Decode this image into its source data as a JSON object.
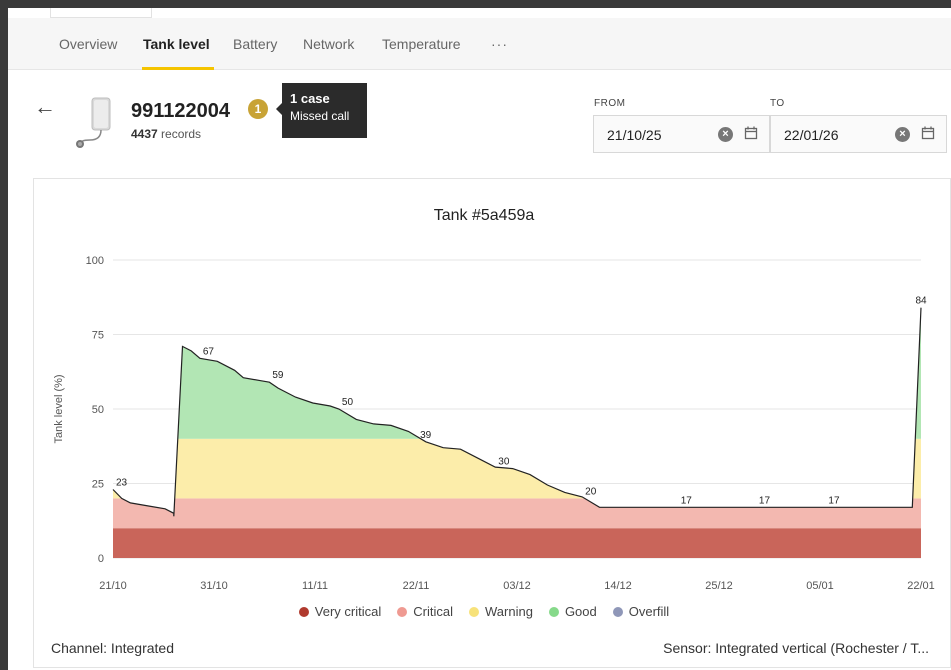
{
  "nav": {
    "tabs": [
      {
        "label": "Overview",
        "active": false
      },
      {
        "label": "Tank level",
        "active": true
      },
      {
        "label": "Battery",
        "active": false
      },
      {
        "label": "Network",
        "active": false
      },
      {
        "label": "Temperature",
        "active": false
      }
    ],
    "more_label": "···"
  },
  "device": {
    "id": "991122004",
    "records_count": "4437",
    "records_label": "records",
    "case_count": "1"
  },
  "tooltip": {
    "title": "1 case",
    "subtitle": "Missed call"
  },
  "dates": {
    "from_label": "FROM",
    "from_value": "21/10/25",
    "to_label": "TO",
    "to_value": "22/01/26"
  },
  "chart_data": {
    "type": "area",
    "title": "Tank #5a459a",
    "ylabel": "Tank level (%)",
    "xlabel": "",
    "ylim": [
      0,
      100
    ],
    "yticks": [
      0,
      25,
      50,
      75,
      100
    ],
    "xticks": [
      "21/10",
      "31/10",
      "11/11",
      "22/11",
      "03/12",
      "14/12",
      "25/12",
      "05/01",
      "22/01"
    ],
    "x_range": [
      "2025-10-21",
      "2026-01-22"
    ],
    "grid": true,
    "zones": [
      {
        "name": "Very critical",
        "from": 0,
        "to": 10,
        "color": "#c9655a"
      },
      {
        "name": "Critical",
        "from": 10,
        "to": 20,
        "color": "#f3b8b0"
      },
      {
        "name": "Warning",
        "from": 20,
        "to": 40,
        "color": "#fcedaa"
      },
      {
        "name": "Good",
        "from": 40,
        "to": 100,
        "color": "#b2e6b4"
      },
      {
        "name": "Overfill",
        "from": null,
        "to": null,
        "color": "#8f97b8"
      }
    ],
    "series": [
      {
        "values": [
          [
            "2025-10-21",
            23
          ],
          [
            "2025-10-22",
            20
          ],
          [
            "2025-10-23",
            18.5
          ],
          [
            "2025-10-25",
            17.5
          ],
          [
            "2025-10-27",
            16.5
          ],
          [
            "2025-10-28",
            15
          ],
          [
            "2025-10-28",
            14
          ],
          [
            "2025-10-29",
            71
          ],
          [
            "2025-10-30",
            69.5
          ],
          [
            "2025-10-31",
            67
          ],
          [
            "2025-11-02",
            66
          ],
          [
            "2025-11-04",
            63
          ],
          [
            "2025-11-05",
            60.5
          ],
          [
            "2025-11-07",
            59.5
          ],
          [
            "2025-11-08",
            59
          ],
          [
            "2025-11-09",
            57
          ],
          [
            "2025-11-11",
            54
          ],
          [
            "2025-11-13",
            52
          ],
          [
            "2025-11-15",
            51
          ],
          [
            "2025-11-16",
            50
          ],
          [
            "2025-11-18",
            46.5
          ],
          [
            "2025-11-20",
            45
          ],
          [
            "2025-11-22",
            44.5
          ],
          [
            "2025-11-24",
            42.5
          ],
          [
            "2025-11-26",
            39
          ],
          [
            "2025-11-28",
            37
          ],
          [
            "2025-11-30",
            36.5
          ],
          [
            "2025-12-02",
            33.5
          ],
          [
            "2025-12-04",
            30.5
          ],
          [
            "2025-12-06",
            30
          ],
          [
            "2025-12-08",
            28
          ],
          [
            "2025-12-10",
            24.5
          ],
          [
            "2025-12-12",
            22
          ],
          [
            "2025-12-14",
            20.5
          ],
          [
            "2025-12-16",
            17
          ],
          [
            "2026-01-21",
            17
          ],
          [
            "2026-01-22",
            84
          ]
        ]
      }
    ],
    "labels": [
      [
        "2025-10-21",
        23
      ],
      [
        "2025-10-31",
        67
      ],
      [
        "2025-11-08",
        59
      ],
      [
        "2025-11-16",
        50
      ],
      [
        "2025-11-25",
        39
      ],
      [
        "2025-12-04",
        30
      ],
      [
        "2025-12-14",
        20
      ],
      [
        "2025-12-25",
        17
      ],
      [
        "2026-01-03",
        17
      ],
      [
        "2026-01-11",
        17
      ],
      [
        "2026-01-22",
        84
      ]
    ]
  },
  "legend": [
    "Very critical",
    "Critical",
    "Warning",
    "Good",
    "Overfill"
  ],
  "footer": {
    "channel": "Channel: Integrated",
    "sensor": "Sensor: Integrated vertical (Rochester / T..."
  }
}
